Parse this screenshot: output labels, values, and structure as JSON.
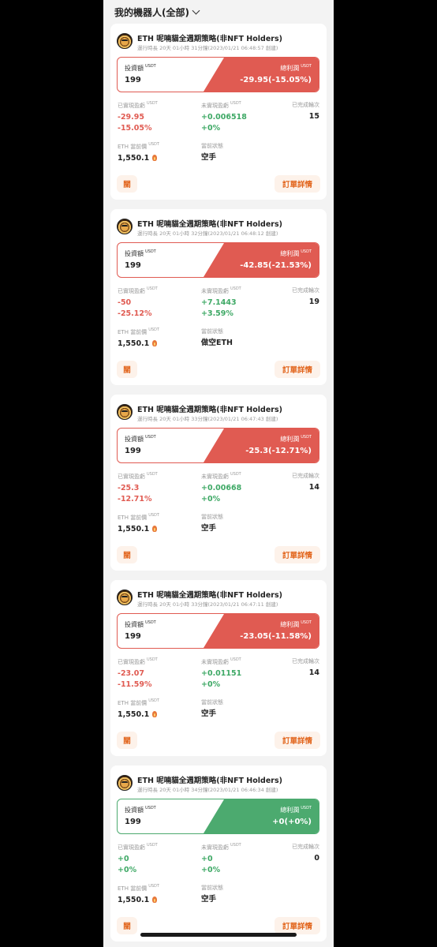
{
  "header": {
    "title": "我的機器人(全部)"
  },
  "labels": {
    "invest": "投資額",
    "total_profit": "總利潤",
    "unit": "USDT",
    "realized": "已實現盈虧",
    "unrealized": "未實現盈虧",
    "rounds": "已完成輪次",
    "price": "ETH 當前價",
    "state": "當前狀態",
    "close_button": "關",
    "detail_button": "訂單詳情"
  },
  "cards": [
    {
      "name": "ETH 呢喃貓全週期策略(非NFT Holders)",
      "runtime": "運行時長 20天 01小時 31分鐘(2023/01/21 06:48:57 創建)",
      "invest": "199",
      "total_profit": "-29.95(-15.05%)",
      "realized": "-29.95",
      "realized_pct": "-15.05%",
      "unrealized": "+0.006518",
      "unrealized_pct": "+0%",
      "rounds": "15",
      "price": "1,550.1",
      "state": "空手",
      "color": "#e05b52"
    },
    {
      "name": "ETH 呢喃貓全週期策略(非NFT Holders)",
      "runtime": "運行時長 20天 01小時 32分鐘(2023/01/21 06:48:12 創建)",
      "invest": "199",
      "total_profit": "-42.85(-21.53%)",
      "realized": "-50",
      "realized_pct": "-25.12%",
      "unrealized": "+7.1443",
      "unrealized_pct": "+3.59%",
      "rounds": "19",
      "price": "1,550.1",
      "state": "做空ETH",
      "color": "#e05b52"
    },
    {
      "name": "ETH 呢喃貓全週期策略(非NFT Holders)",
      "runtime": "運行時長 20天 01小時 33分鐘(2023/01/21 06:47:43 創建)",
      "invest": "199",
      "total_profit": "-25.3(-12.71%)",
      "realized": "-25.3",
      "realized_pct": "-12.71%",
      "unrealized": "+0.00668",
      "unrealized_pct": "+0%",
      "rounds": "14",
      "price": "1,550.1",
      "state": "空手",
      "color": "#e05b52"
    },
    {
      "name": "ETH 呢喃貓全週期策略(非NFT Holders)",
      "runtime": "運行時長 20天 01小時 33分鐘(2023/01/21 06:47:11 創建)",
      "invest": "199",
      "total_profit": "-23.05(-11.58%)",
      "realized": "-23.07",
      "realized_pct": "-11.59%",
      "unrealized": "+0.01151",
      "unrealized_pct": "+0%",
      "rounds": "14",
      "price": "1,550.1",
      "state": "空手",
      "color": "#e05b52"
    },
    {
      "name": "ETH 呢喃貓全週期策略(非NFT Holders)",
      "runtime": "運行時長 20天 01小時 34分鐘(2023/01/21 06:46:34 創建)",
      "invest": "199",
      "total_profit": "+0(+0%)",
      "realized": "+0",
      "realized_pct": "+0%",
      "unrealized": "+0",
      "unrealized_pct": "+0%",
      "rounds": "0",
      "price": "1,550.1",
      "state": "空手",
      "color": "#4caa6f"
    }
  ]
}
